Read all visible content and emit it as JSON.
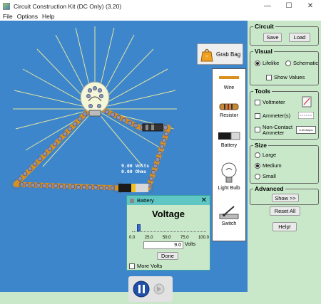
{
  "window": {
    "title": "Circuit Construction Kit (DC Only) (3.20)",
    "controls": {
      "minimize": "—",
      "maximize": "☐",
      "close": "✕"
    }
  },
  "menu": [
    "File",
    "Options",
    "Help"
  ],
  "grab_bag": {
    "label": "Grab Bag"
  },
  "toolbox": {
    "wire": "Wire",
    "resistor": "Resistor",
    "battery": "Battery",
    "light_bulb": "Light Bulb",
    "switch": "Switch"
  },
  "battery_readout": {
    "volts": "9.00 Volts",
    "ohms": "0.00 Ohms"
  },
  "panel": {
    "circuit": {
      "title": "Circuit",
      "save": "Save",
      "load": "Load"
    },
    "visual": {
      "title": "Visual",
      "lifelike": "Lifelike",
      "schematic": "Schematic",
      "show_values": "Show Values"
    },
    "tools": {
      "title": "Tools",
      "voltmeter": "Voltmeter",
      "ammeter": "Ammeter(s)",
      "noncontact_line1": "Non-Contact",
      "noncontact_line2": "Ammeter",
      "ammeter_display": "0.00 Amps"
    },
    "size": {
      "title": "Size",
      "large": "Large",
      "medium": "Medium",
      "small": "Small"
    },
    "advanced": {
      "title": "Advanced",
      "show": "Show >>"
    },
    "reset_all": "Reset All",
    "help": "Help!"
  },
  "dialog": {
    "title": "Battery",
    "heading": "Voltage",
    "slider_ticks": [
      "0.0",
      "25.0",
      "50.0",
      "75.0",
      "100.0"
    ],
    "slider_value_fraction": 0.09,
    "value": "9.0",
    "unit": "Volts",
    "done": "Done",
    "more_volts": "More Volts"
  },
  "colors": {
    "workspace": "#3e86cc",
    "background": "#c9e8c9",
    "wire": "#d9901c",
    "dialog_title": "#5fc6c4"
  }
}
